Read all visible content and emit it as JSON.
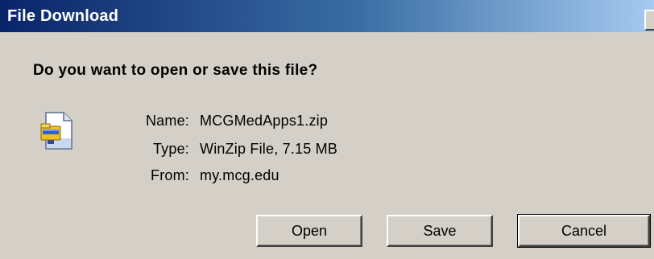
{
  "window": {
    "title": "File Download"
  },
  "dialog": {
    "question": "Do you want to open or save this file?",
    "file": {
      "name_label": "Name:",
      "name_value": "MCGMedApps1.zip",
      "type_label": "Type:",
      "type_value": "WinZip File, 7.15 MB",
      "from_label": "From:",
      "from_value": "my.mcg.edu"
    },
    "buttons": {
      "open": "Open",
      "save": "Save",
      "cancel": "Cancel"
    }
  },
  "colors": {
    "titlebar_start": "#0a246a",
    "titlebar_end": "#a6caf0",
    "face": "#d4d0c8"
  },
  "icons": {
    "file": "winzip-file-icon"
  }
}
